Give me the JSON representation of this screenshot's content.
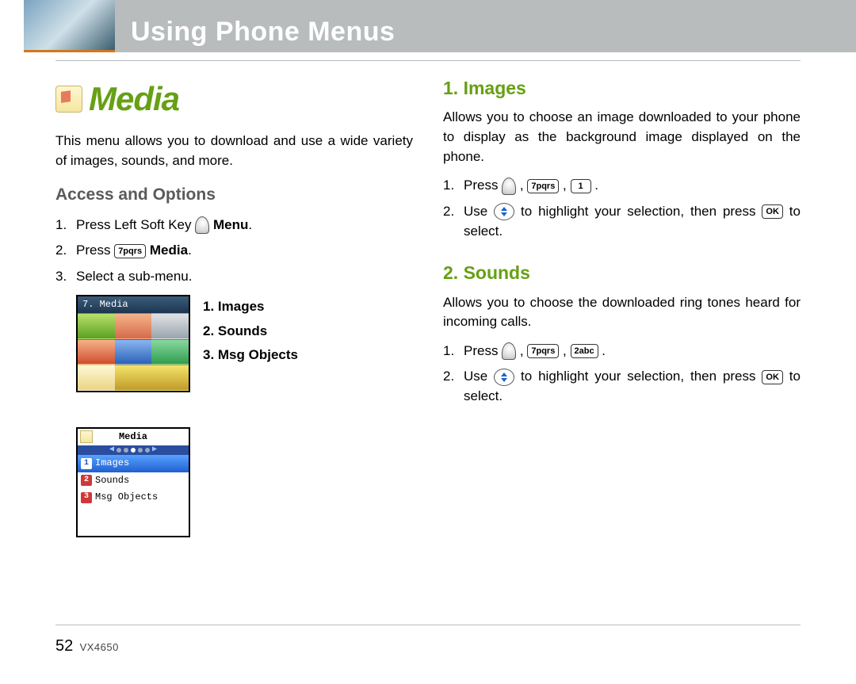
{
  "header": {
    "title": "Using Phone Menus"
  },
  "left": {
    "media_title": "Media",
    "intro": "This menu allows you to download and use a wide variety of images, sounds, and more.",
    "access_heading": "Access and Options",
    "step1_a": "Press Left Soft Key ",
    "step1_b": " Menu",
    "step1_c": ".",
    "step2_a": "Press ",
    "step2_key": "7pqrs",
    "step2_b": " Media",
    "step2_c": ".",
    "step3": "Select a sub-menu.",
    "sublist": {
      "i1": "1. Images",
      "i2": "2. Sounds",
      "i3": "3. Msg Objects"
    },
    "shot1_header": "7. Media",
    "shot2_title": "Media",
    "shot2_items": {
      "r1": "Images",
      "r2": "Sounds",
      "r3": "Msg Objects"
    }
  },
  "right": {
    "sec1_head": "1. Images",
    "sec1_desc": "Allows you to choose an image downloaded to your phone to display as the background image displayed on the phone.",
    "sec1_s1_a": "Press ",
    "sec1_s1_k1": "7pqrs",
    "sec1_s1_k2": "1",
    "sec1_s2_a": "Use ",
    "sec1_s2_b": " to highlight your selection, then press ",
    "sec1_s2_ok": "OK",
    "sec1_s2_c": " to select.",
    "sec2_head": "2. Sounds",
    "sec2_desc": "Allows you to choose the downloaded ring tones heard for incoming calls.",
    "sec2_s1_k1": "7pqrs",
    "sec2_s1_k2": "2abc",
    "sec2_s2_a": "Use ",
    "sec2_s2_b": " to highlight your selection, then press ",
    "sec2_s2_ok": "OK",
    "sec2_s2_c": " to select."
  },
  "footer": {
    "page": "52",
    "model": "VX4650"
  }
}
